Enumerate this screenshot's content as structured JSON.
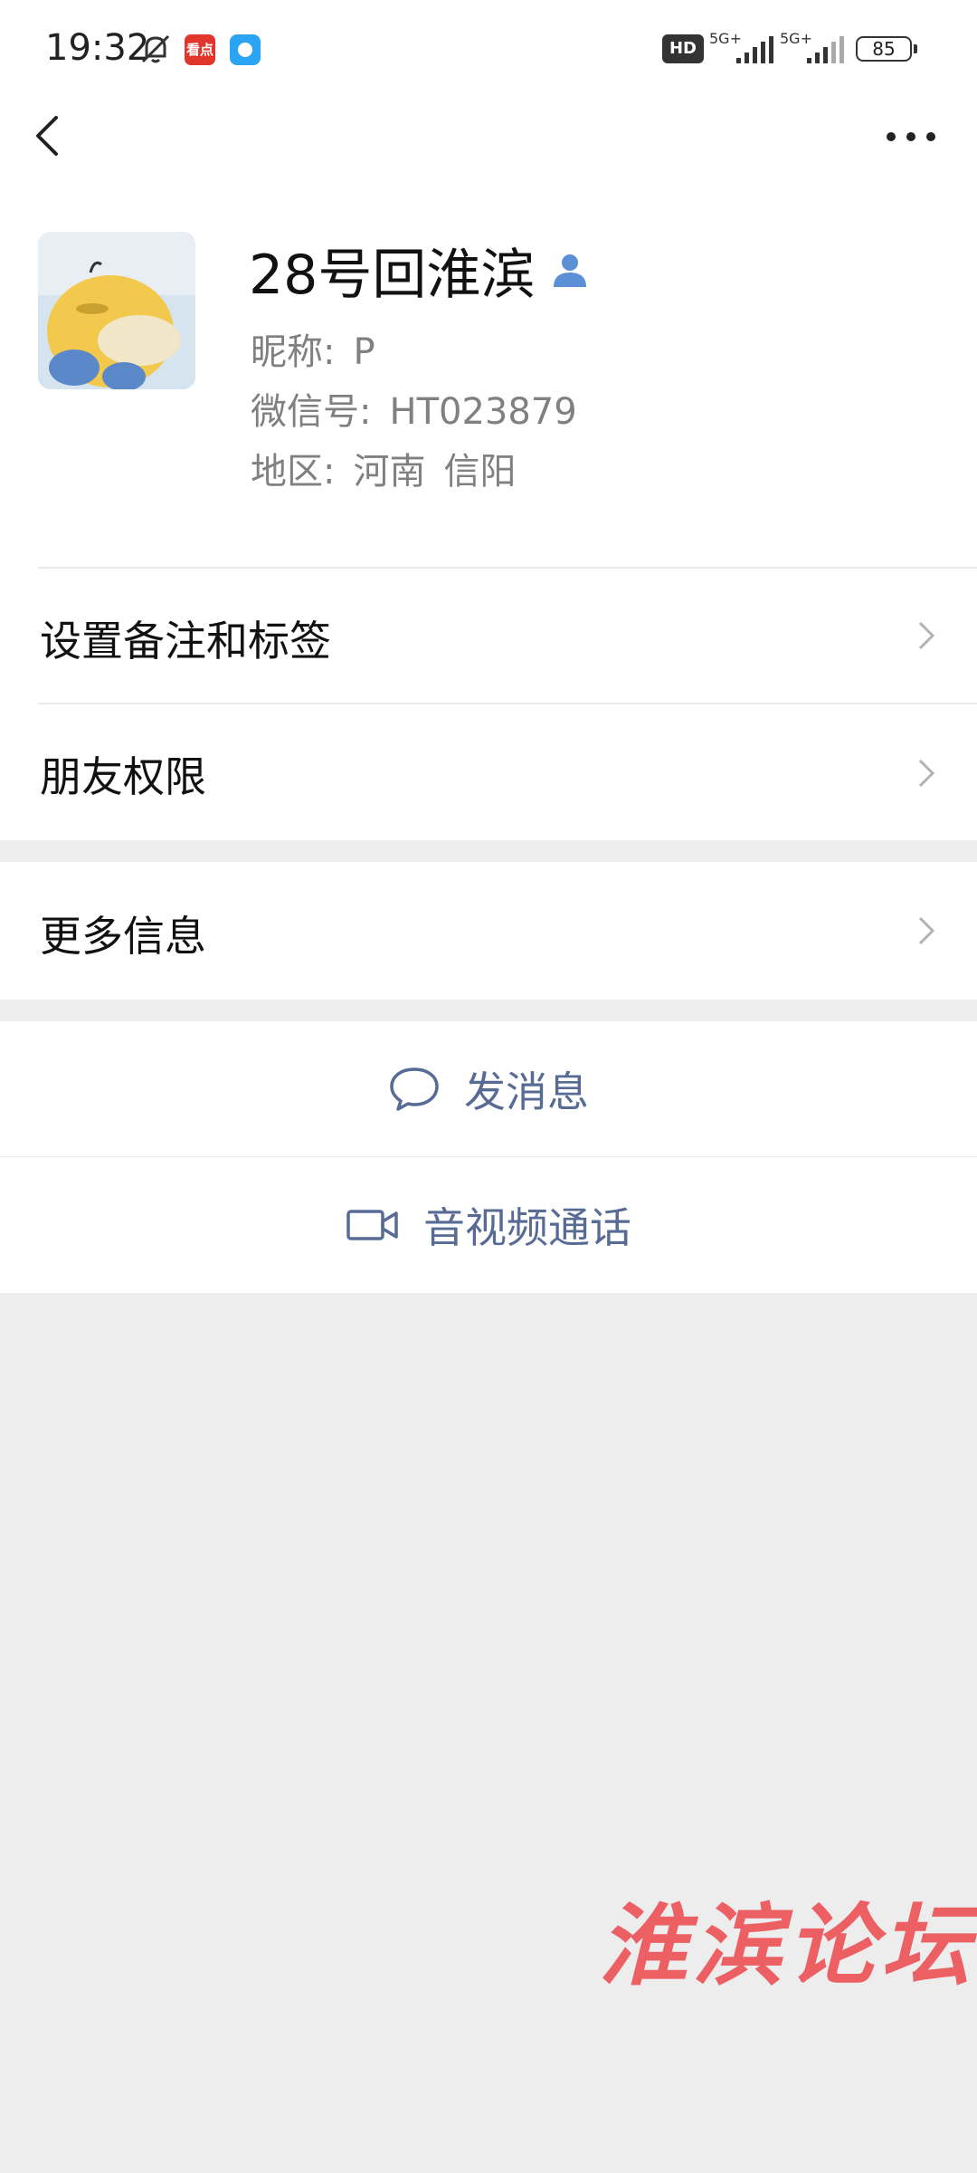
{
  "status_bar": {
    "time": "19:32",
    "app1_label": "看点",
    "hd_label": "HD",
    "signal1_label": "5G+",
    "signal2_label": "5G+",
    "battery": "85",
    "icons": [
      "bell-off-icon",
      "news-app-icon",
      "chat-app-icon",
      "hd-voice-icon",
      "signal-icon",
      "battery-icon"
    ]
  },
  "nav": {
    "back_icon": "chevron-left-icon",
    "more_icon": "more-dots-icon"
  },
  "profile": {
    "name": "28号回淮滨",
    "nickname_label": "昵称:",
    "nickname": "P",
    "wechat_id_label": "微信号:",
    "wechat_id": "HT023879",
    "region_label": "地区:",
    "region_province": "河南",
    "region_city": "信阳"
  },
  "menu": {
    "remarks_label": "设置备注和标签",
    "permissions_label": "朋友权限",
    "more_info_label": "更多信息"
  },
  "actions": {
    "message_label": "发消息",
    "call_label": "音视频通话"
  },
  "colors": {
    "accent_link": "#576b95",
    "background": "#ededed",
    "watermark": "#ec5358"
  },
  "watermark": "淮滨论坛"
}
